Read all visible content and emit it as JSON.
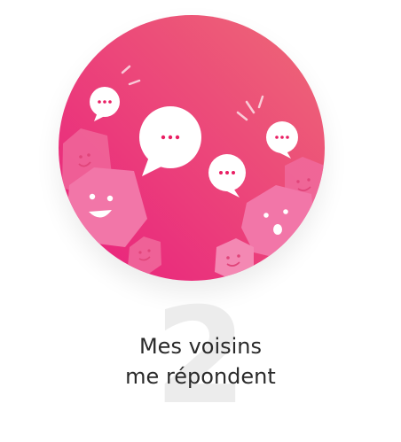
{
  "step": {
    "number": "2",
    "title_line1": "Mes voisins",
    "title_line2": "me répondent"
  },
  "illustration": {
    "icon": "neighbors-chat-illustration",
    "gradient_start": "#ee6a76",
    "gradient_end": "#e91e7e",
    "accent": "#e91e63"
  }
}
